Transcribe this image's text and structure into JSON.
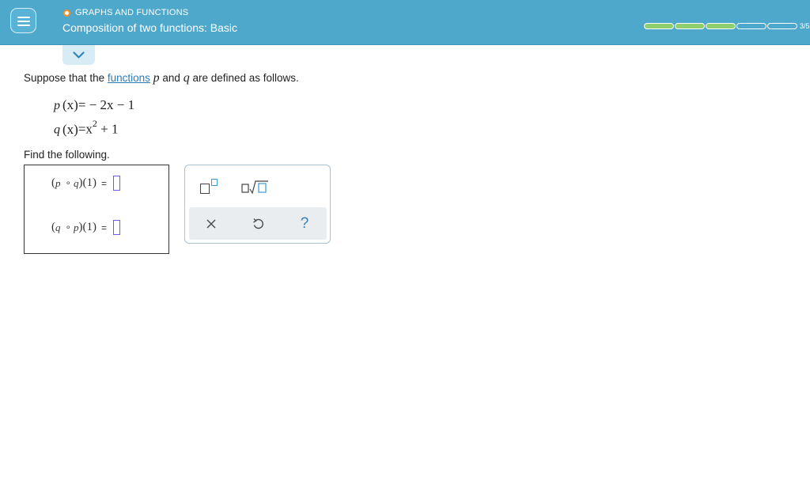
{
  "header": {
    "topic": "GRAPHS AND FUNCTIONS",
    "lesson_title": "Composition of two functions: Basic",
    "progress": {
      "completed": 3,
      "total": 5,
      "label": "3/5"
    }
  },
  "problem": {
    "intro_before": "Suppose that the ",
    "intro_link": "functions",
    "intro_var1": "p",
    "intro_and": " and ",
    "intro_var2": "q",
    "intro_after": " are defined as follows.",
    "p_def": {
      "lhs": "p",
      "arg": "(x)",
      "rhs": "= − 2x − 1"
    },
    "q_def": {
      "lhs": "q",
      "arg": "(x)",
      "rhs_a": "=x",
      "exp": "2",
      "rhs_b": " + 1"
    },
    "find_label": "Find the following.",
    "compositions": [
      {
        "outer": "p",
        "inner": "q",
        "arg": "(1)",
        "eq": "="
      },
      {
        "outer": "q",
        "inner": "p",
        "arg": "(1)",
        "eq": "="
      }
    ]
  },
  "palette": {
    "icons": [
      "superscript-icon",
      "square-root-icon",
      "clear-icon",
      "undo-icon",
      "help-icon"
    ],
    "help_label": "?"
  },
  "colors": {
    "header_bg": "#4ea8cc",
    "progress_fill": "#8fcf6e",
    "topic_dot": "#ff8f1c",
    "link": "#2b7bb8",
    "input_slot": "#6b5ce7"
  }
}
